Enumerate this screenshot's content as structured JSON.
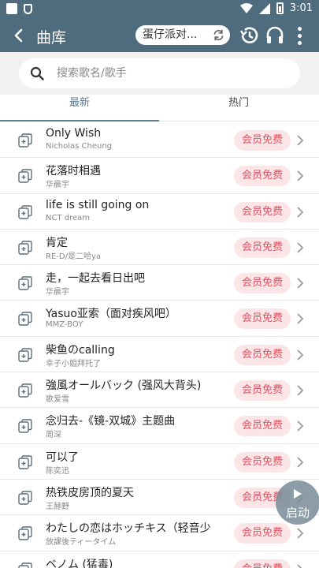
{
  "status_bar": {
    "time": "3:01"
  },
  "app_bar": {
    "title": "曲库",
    "current_song_chip": "蛋仔派对...",
    "icons": [
      "back-arrow-icon",
      "refresh-icon",
      "history-icon",
      "headphones-icon",
      "more-vert-icon"
    ]
  },
  "search": {
    "placeholder": "搜索歌名/歌手",
    "value": ""
  },
  "tabs": [
    {
      "label": "最新",
      "active": true
    },
    {
      "label": "热门",
      "active": false
    }
  ],
  "songs": [
    {
      "title": "Only Wish",
      "artist": "Nicholas Cheung",
      "badge": "会员免费"
    },
    {
      "title": "花落时相遇",
      "artist": "华晨宇",
      "badge": "会员免费"
    },
    {
      "title": "life is still going on",
      "artist": "NCT dream",
      "badge": "会员免费"
    },
    {
      "title": "肯定",
      "artist": "RE-D/是二哈ya",
      "badge": "会员免费"
    },
    {
      "title": "走，一起去看日出吧",
      "artist": "华晨宇",
      "badge": "会员免费"
    },
    {
      "title": "Yasuo亚索（面对疾风吧）",
      "artist": "MMZ-BOY",
      "badge": "会员免费"
    },
    {
      "title": "柴鱼のcalling",
      "artist": "幸子小姐拜托了",
      "badge": "会员免费"
    },
    {
      "title": "強風オールバック (强风大背头)",
      "artist": "歌爱雪",
      "badge": "会员免费"
    },
    {
      "title": "念归去-《镜-双城》主题曲",
      "artist": "周深",
      "badge": "会员免费"
    },
    {
      "title": "可以了",
      "artist": "陈奕迅",
      "badge": "会员免费"
    },
    {
      "title": "热铁皮房顶的夏天",
      "artist": "王赫野",
      "badge": "会员免费"
    },
    {
      "title": "わたしの恋はホッチキス（轻音少",
      "artist": "放課後ティータイム",
      "badge": "会员免费"
    },
    {
      "title": "ベノム (猛毒)",
      "artist": "",
      "badge": "会员免费"
    }
  ],
  "fab": {
    "label": "启动"
  },
  "colors": {
    "primary": "#4f6c7e",
    "vip_bg": "#fbe5e7",
    "vip_text": "#e05262",
    "tab_active": "#5c7a8c"
  }
}
